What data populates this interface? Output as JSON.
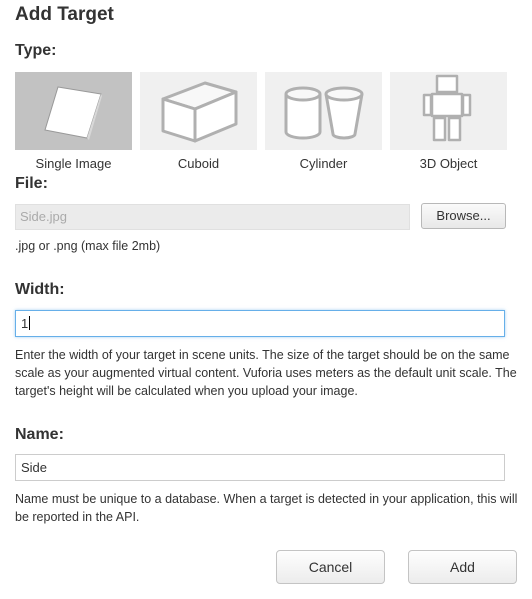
{
  "title": "Add Target",
  "type_section": {
    "label": "Type:",
    "options": [
      {
        "label": "Single Image",
        "icon": "single-image-icon",
        "selected": true
      },
      {
        "label": "Cuboid",
        "icon": "cuboid-icon",
        "selected": false
      },
      {
        "label": "Cylinder",
        "icon": "cylinder-icon",
        "selected": false
      },
      {
        "label": "3D Object",
        "icon": "3d-object-icon",
        "selected": false
      }
    ]
  },
  "file_section": {
    "label": "File:",
    "value": "Side.jpg",
    "browse_label": "Browse...",
    "hint": ".jpg or .png (max file 2mb)"
  },
  "width_section": {
    "label": "Width:",
    "value": "1",
    "hint": "Enter the width of your target in scene units. The size of the target should be on the same scale as your augmented virtual content. Vuforia uses meters as the default unit scale. The target's height will be calculated when you upload your image."
  },
  "name_section": {
    "label": "Name:",
    "value": "Side",
    "hint": "Name must be unique to a database. When a target is detected in your application, this will be reported in the API."
  },
  "actions": {
    "cancel_label": "Cancel",
    "add_label": "Add"
  },
  "colors": {
    "selected_tile": "#c2c2c2",
    "tile": "#f0f0f0",
    "focus_border": "#66afe9"
  }
}
